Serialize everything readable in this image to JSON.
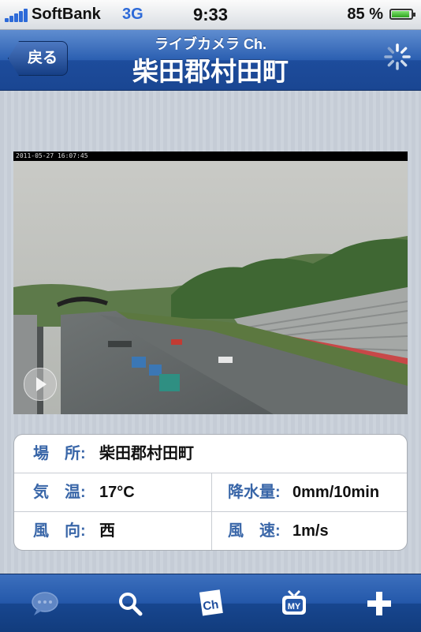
{
  "status_bar": {
    "carrier": "SoftBank",
    "network": "3G",
    "time": "9:33",
    "battery_percent": "85 %",
    "battery_level": 0.85
  },
  "nav": {
    "back_label": "戻る",
    "subtitle": "ライブカメラ Ch.",
    "title": "柴田郡村田町",
    "activity_icon": "spinner-icon"
  },
  "camera": {
    "timestamp": "2011-05-27 16:07:45"
  },
  "info": {
    "location": {
      "label": "場　所:",
      "value": "柴田郡村田町"
    },
    "temperature": {
      "label": "気　温:",
      "value": "17°C"
    },
    "precipitation": {
      "label": "降水量:",
      "value": "0mm/10min"
    },
    "wind_direction": {
      "label": "風　向:",
      "value": "西"
    },
    "wind_speed": {
      "label": "風　速:",
      "value": "1m/s"
    }
  },
  "tabs": [
    {
      "icon": "chat-bubble-icon"
    },
    {
      "icon": "search-icon"
    },
    {
      "icon": "channel-icon",
      "text": "Ch"
    },
    {
      "icon": "my-tv-icon",
      "text": "MY"
    },
    {
      "icon": "plus-icon"
    }
  ],
  "colors": {
    "nav_blue": "#2b5fb1",
    "label_blue": "#3966a8"
  }
}
